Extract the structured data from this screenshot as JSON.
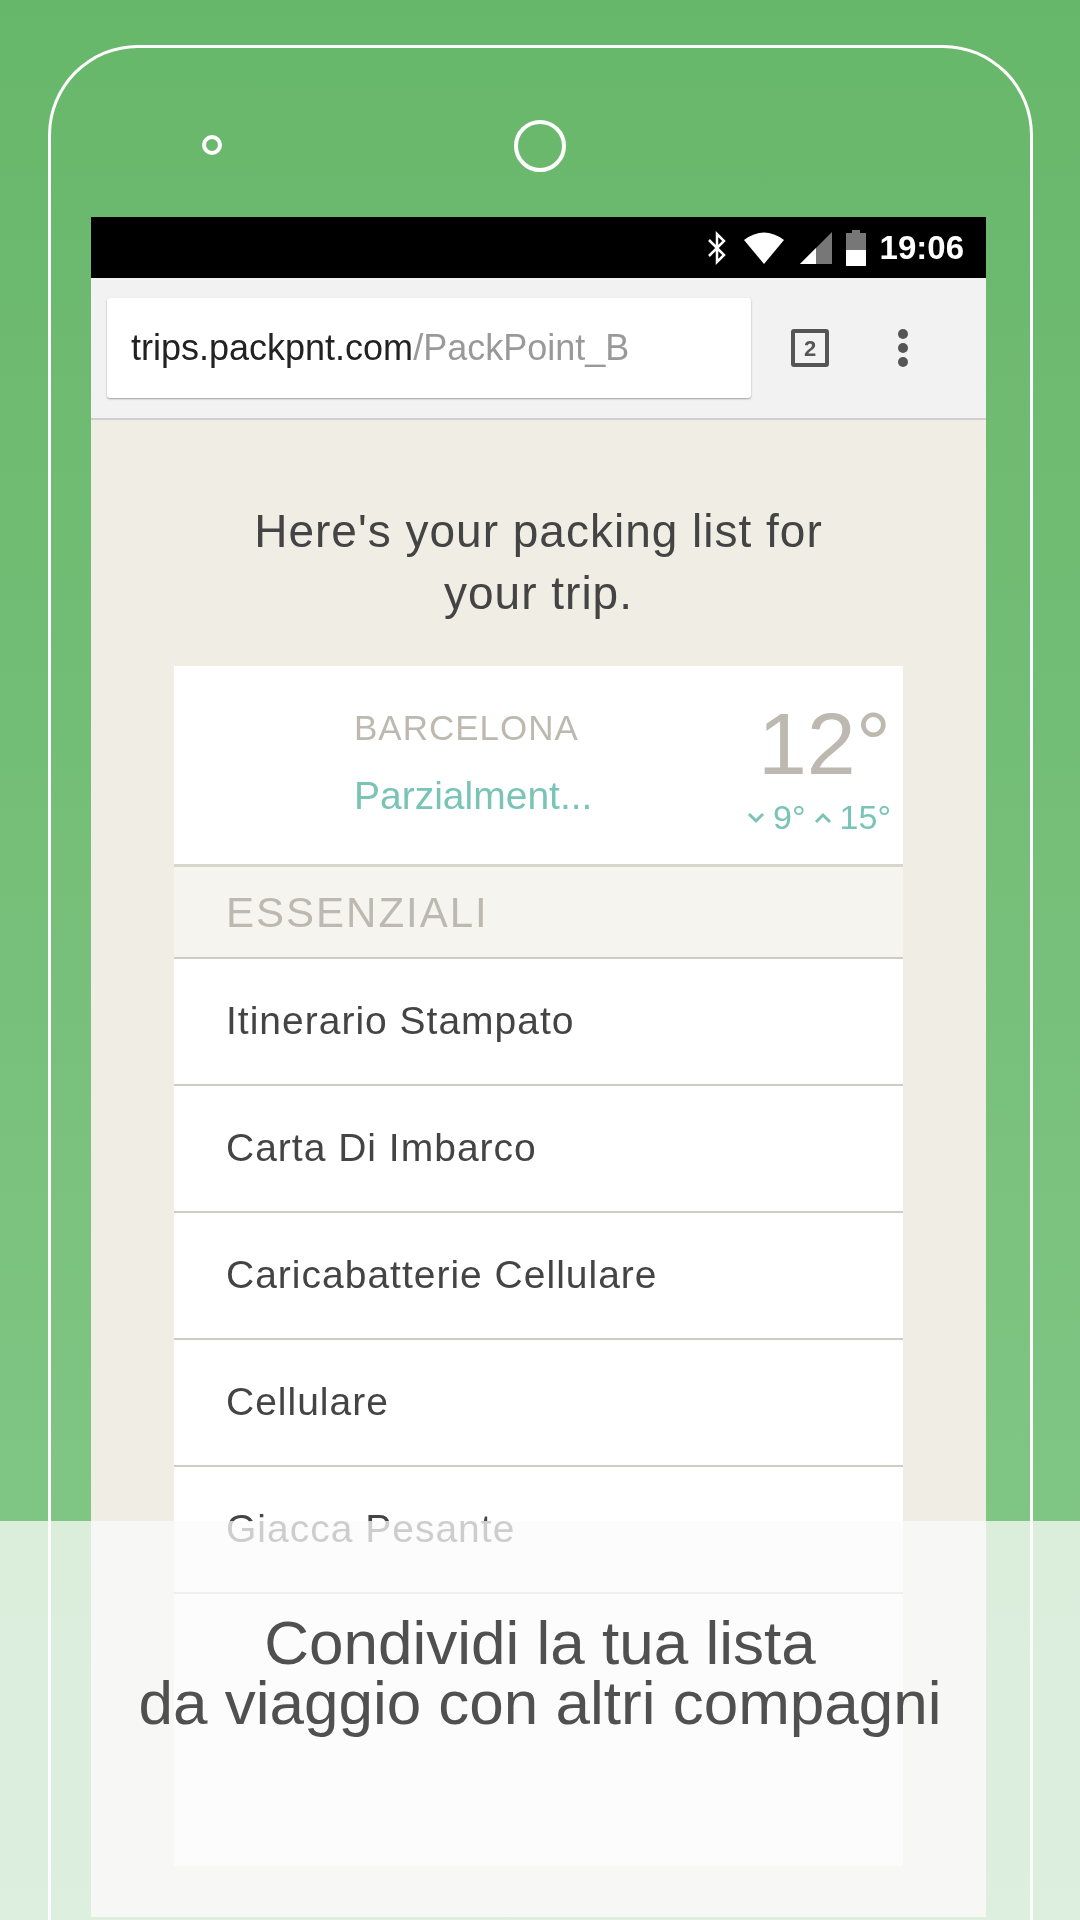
{
  "status_bar": {
    "time": "19:06"
  },
  "browser": {
    "url_host": "trips.packpnt.com",
    "url_path": "/PackPoint_B",
    "tab_count": "2"
  },
  "heading": "Here's your packing list for your trip.",
  "weather": {
    "city": "BARCELONA",
    "condition": "Parzialment...",
    "temperature": "12°",
    "low": "9°",
    "high": "15°"
  },
  "section": {
    "title": "ESSENZIALI"
  },
  "items": [
    {
      "label": "Itinerario Stampato"
    },
    {
      "label": "Carta Di Imbarco"
    },
    {
      "label": "Caricabatterie Cellulare"
    },
    {
      "label": "Cellulare"
    },
    {
      "label": "Giacca Pesante"
    }
  ],
  "promo": {
    "lines": [
      "Condividi la tua lista",
      "da viaggio con altri compagni"
    ]
  }
}
